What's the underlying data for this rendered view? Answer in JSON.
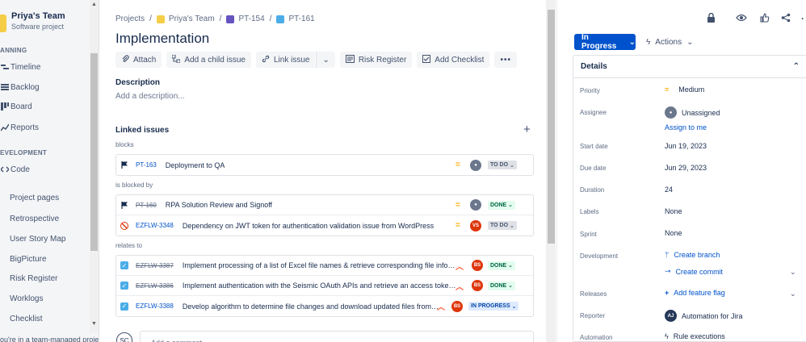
{
  "sidebar": {
    "team_name": "Priya's Team",
    "team_type": "Software project",
    "sections": [
      {
        "label": "PLANNING",
        "visible_label": "ANNING"
      },
      {
        "label": "DEVELOPMENT",
        "visible_label": "EVELOPMENT"
      }
    ],
    "planning_items": [
      {
        "label": "Timeline",
        "icon": "timeline-icon"
      },
      {
        "label": "Backlog",
        "icon": "backlog-icon"
      },
      {
        "label": "Board",
        "icon": "board-icon"
      },
      {
        "label": "Reports",
        "icon": "reports-icon"
      }
    ],
    "development_items": [
      {
        "label": "Code",
        "icon": "code-icon"
      }
    ],
    "extra_items": [
      {
        "label": "Project pages"
      },
      {
        "label": "Retrospective"
      },
      {
        "label": "User Story Map"
      },
      {
        "label": "BigPicture"
      },
      {
        "label": "Risk Register"
      },
      {
        "label": "Worklogs"
      },
      {
        "label": "Checklist"
      }
    ],
    "footer_note": "ou're in a team-managed project"
  },
  "breadcrumb": {
    "items": [
      "Projects",
      "Priya's Team",
      "PT-154",
      "PT-161"
    ]
  },
  "issue": {
    "title": "Implementation"
  },
  "toolbar": {
    "buttons": [
      {
        "label": "Attach",
        "icon": "paperclip-icon"
      },
      {
        "label": "Add a child issue",
        "icon": "child-issue-icon"
      },
      {
        "label": "Link issue",
        "icon": "link-icon"
      },
      {
        "label": "",
        "icon": "chevron-down-icon"
      },
      {
        "label": "Risk Register",
        "icon": "risk-register-icon"
      },
      {
        "label": "Add Checklist",
        "icon": "checklist-icon"
      },
      {
        "label": "",
        "icon": "more-icon"
      }
    ]
  },
  "description": {
    "heading": "Description",
    "placeholder": "Add a description..."
  },
  "linked": {
    "heading": "Linked issues",
    "groups": [
      {
        "label": "blocks",
        "issues": [
          {
            "key": "PT-163",
            "summary": "Deployment to QA",
            "done": false,
            "type": "flag",
            "priority": "medium",
            "assignee": "",
            "status": "TO DO"
          }
        ]
      },
      {
        "label": "is blocked by",
        "issues": [
          {
            "key": "PT-160",
            "summary": "RPA Solution Review and Signoff",
            "done": true,
            "type": "flag",
            "priority": "medium",
            "assignee": "",
            "status": "DONE"
          },
          {
            "key": "EZFLW-3348",
            "summary": "Dependency on JWT token for authentication validation issue from WordPress",
            "done": false,
            "type": "blocker",
            "priority": "medium",
            "assignee": "VS",
            "status": "TO DO"
          }
        ]
      },
      {
        "label": "relates to",
        "issues": [
          {
            "key": "EZFLW-3387",
            "summary": "Implement processing of a list of Excel file names & retrieve corresponding file informa...",
            "done": true,
            "type": "task",
            "priority": "high",
            "assignee": "BS",
            "status": "DONE"
          },
          {
            "key": "EZFLW-3386",
            "summary": "Implement authentication with the Seismic OAuth APIs and retrieve an access token usi...",
            "done": true,
            "type": "task",
            "priority": "high",
            "assignee": "BS",
            "status": "DONE"
          },
          {
            "key": "EZFLW-3388",
            "summary": "Develop algorithm to determine file changes and download updated files from S...",
            "done": false,
            "type": "task",
            "priority": "high",
            "assignee": "BS",
            "status": "IN PROGRESS"
          }
        ]
      }
    ]
  },
  "comment": {
    "avatar": "SC",
    "placeholder": "Add a comment..."
  },
  "right": {
    "status_label": "In Progress",
    "actions_label": "Actions",
    "details_heading": "Details",
    "fields": [
      {
        "label": "Priority",
        "value": "Medium"
      },
      {
        "label": "Assignee",
        "value": "Unassigned",
        "sub": "Assign to me"
      },
      {
        "label": "Start date",
        "value": "Jun 19, 2023"
      },
      {
        "label": "Due date",
        "value": "Jun 29, 2023"
      },
      {
        "label": "Duration",
        "value": "24"
      },
      {
        "label": "Labels",
        "value": "None"
      },
      {
        "label": "Sprint",
        "value": "None"
      },
      {
        "label": "Development",
        "value": "Create branch",
        "sub": "Create commit"
      },
      {
        "label": "Releases",
        "value": "Add feature flag"
      },
      {
        "label": "Reporter",
        "value": "Automation for Jira",
        "avatar": "AJ"
      },
      {
        "label": "Automation",
        "value": "Rule executions"
      }
    ]
  },
  "colors": {
    "accent": "#0052cc",
    "priority_medium": "#ffab00",
    "priority_high": "#ff5630",
    "avatar_red": "#de350b"
  }
}
